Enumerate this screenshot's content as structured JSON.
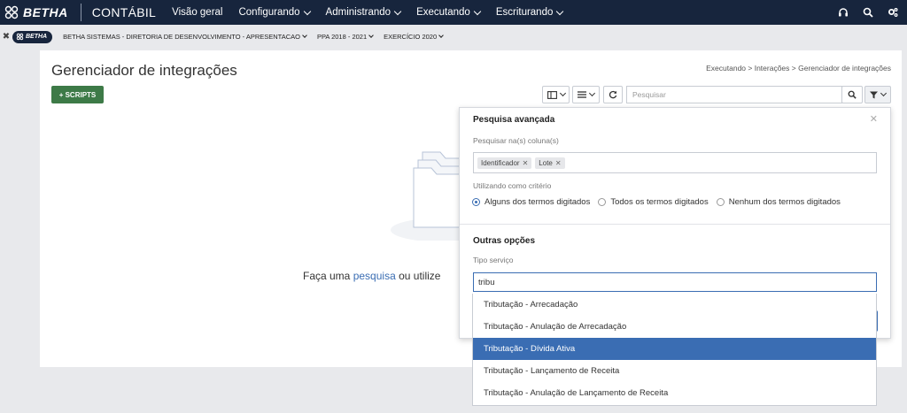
{
  "topbar": {
    "brand": "BETHA",
    "app_name": "CONTÁBIL",
    "nav": [
      {
        "label": "Visão geral",
        "has_menu": false
      },
      {
        "label": "Configurando",
        "has_menu": true
      },
      {
        "label": "Administrando",
        "has_menu": true
      },
      {
        "label": "Executando",
        "has_menu": true
      },
      {
        "label": "Escriturando",
        "has_menu": true
      }
    ],
    "icons": [
      "headset-icon",
      "search-icon",
      "gears-icon"
    ]
  },
  "context": {
    "badge": "BETHA",
    "entity": "BETHA SISTEMAS - DIRETORIA DE DESENVOLVIMENTO - APRESENTACAO",
    "ppa": "PPA 2018 - 2021",
    "exercicio": "EXERCÍCIO 2020"
  },
  "page": {
    "title": "Gerenciador de integrações",
    "breadcrumb": "Executando > Interações > Gerenciador de integrações",
    "scripts_button": "+ SCRIPTS",
    "search_placeholder": "Pesquisar",
    "empty_prefix": "Faça uma ",
    "empty_link": "pesquisa",
    "empty_suffix": " ou utilize"
  },
  "advanced_search": {
    "title": "Pesquisa avançada",
    "columns_label": "Pesquisar na(s) coluna(s)",
    "columns": [
      "Identificador",
      "Lote"
    ],
    "criteria_label": "Utilizando como critério",
    "criteria": [
      {
        "label": "Alguns dos termos digitados",
        "selected": true
      },
      {
        "label": "Todos os termos digitados",
        "selected": false
      },
      {
        "label": "Nenhum dos termos digitados",
        "selected": false
      }
    ],
    "other_title": "Outras opções",
    "service_label": "Tipo serviço",
    "service_value": "tribu"
  },
  "dropdown": {
    "options": [
      "Tributação - Arrecadação",
      "Tributação - Anulação de Arrecadação",
      "Tributação - Dívida Ativa",
      "Tributação - Lançamento de Receita",
      "Tributação - Anulação de Lançamento de Receita"
    ],
    "highlighted_index": 2
  },
  "colors": {
    "topbar": "#17253d",
    "primary_green": "#3d7a47",
    "accent_blue": "#3a6db3"
  }
}
